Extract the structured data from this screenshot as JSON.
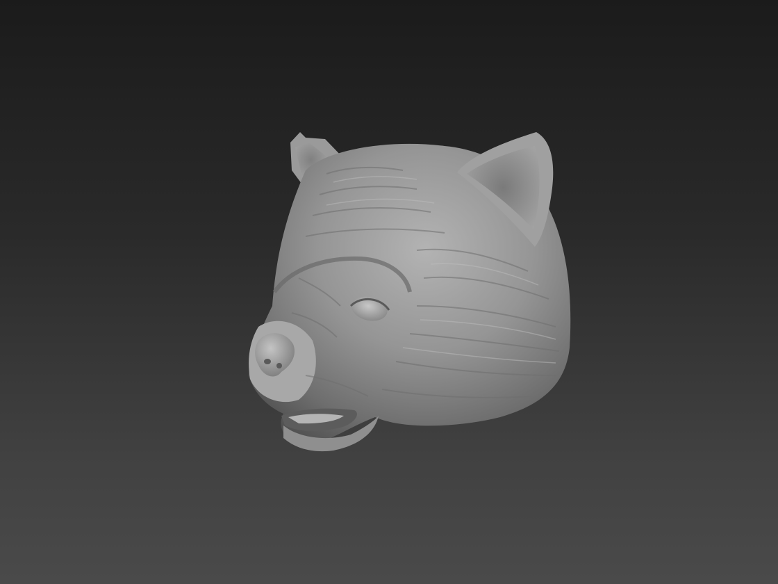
{
  "scene": {
    "subject": "sculpted-animal-head",
    "material_color": "#8c8c8c",
    "background_top": "#1b1b1b",
    "background_bottom": "#4a4a4a"
  }
}
